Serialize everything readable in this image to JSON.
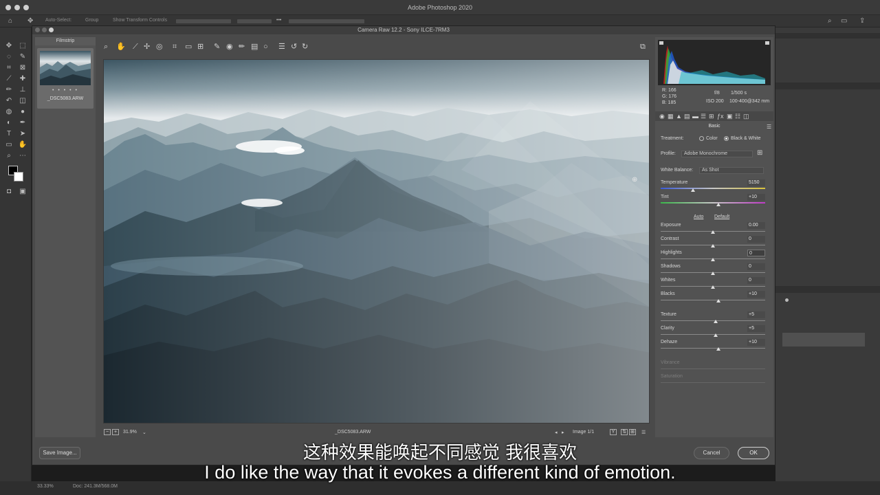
{
  "app": {
    "title": "Adobe Photoshop 2020"
  },
  "options_bar": {
    "auto_select": "Auto-Select:",
    "group": "Group",
    "show_transform": "Show Transform Controls",
    "more": "•••"
  },
  "dialog": {
    "title": "Camera Raw 12.2  -  Sony ILCE-7RM3",
    "filmstrip_label": "Filmstrip",
    "thumb_stars": "• • • • •",
    "thumb_name": "_DSC5083.ARW",
    "zoom": "31.9%",
    "filename": "_DSC5083.ARW",
    "image_count": "Image 1/1",
    "save_label": "Save Image...",
    "cancel_label": "Cancel",
    "ok_label": "OK"
  },
  "readouts": {
    "r": "R:  166",
    "g": "G:  176",
    "b": "B:  185",
    "aperture": "f/8",
    "shutter": "1/500 s",
    "iso": "ISO 200",
    "lens": "100-400@342 mm"
  },
  "panel": {
    "section": "Basic",
    "treatment_label": "Treatment:",
    "color_option": "Color",
    "bw_option": "Black & White",
    "profile_label": "Profile:",
    "profile_value": "Adobe Monochrome",
    "wb_label": "White Balance:",
    "wb_value": "As Shot",
    "auto": "Auto",
    "default": "Default",
    "sliders": {
      "temperature": {
        "label": "Temperature",
        "value": "5150",
        "pos": 0.31
      },
      "tint": {
        "label": "Tint",
        "value": "+10",
        "pos": 0.55
      },
      "exposure": {
        "label": "Exposure",
        "value": "0.00",
        "pos": 0.5
      },
      "contrast": {
        "label": "Contrast",
        "value": "0",
        "pos": 0.5
      },
      "highlights": {
        "label": "Highlights",
        "value": "0",
        "pos": 0.5
      },
      "shadows": {
        "label": "Shadows",
        "value": "0",
        "pos": 0.5
      },
      "whites": {
        "label": "Whites",
        "value": "0",
        "pos": 0.5
      },
      "blacks": {
        "label": "Blacks",
        "value": "+10",
        "pos": 0.55
      },
      "texture": {
        "label": "Texture",
        "value": "+5",
        "pos": 0.525
      },
      "clarity": {
        "label": "Clarity",
        "value": "+5",
        "pos": 0.525
      },
      "dehaze": {
        "label": "Dehaze",
        "value": "+10",
        "pos": 0.55
      }
    },
    "vibrance": "Vibrance",
    "saturation": "Saturation"
  },
  "status": {
    "zoom": "33.33%",
    "doc": "Doc: 241.3M/568.0M"
  },
  "subtitles": {
    "cn": "这种效果能唤起不同感觉 我很喜欢",
    "en": "I do like the way that it evokes a different kind of emotion."
  },
  "colors": {
    "bg": "#4a4a4a",
    "panel": "#525252",
    "photo_dark": "#1e2a32",
    "photo_light": "#dfe4e6"
  }
}
